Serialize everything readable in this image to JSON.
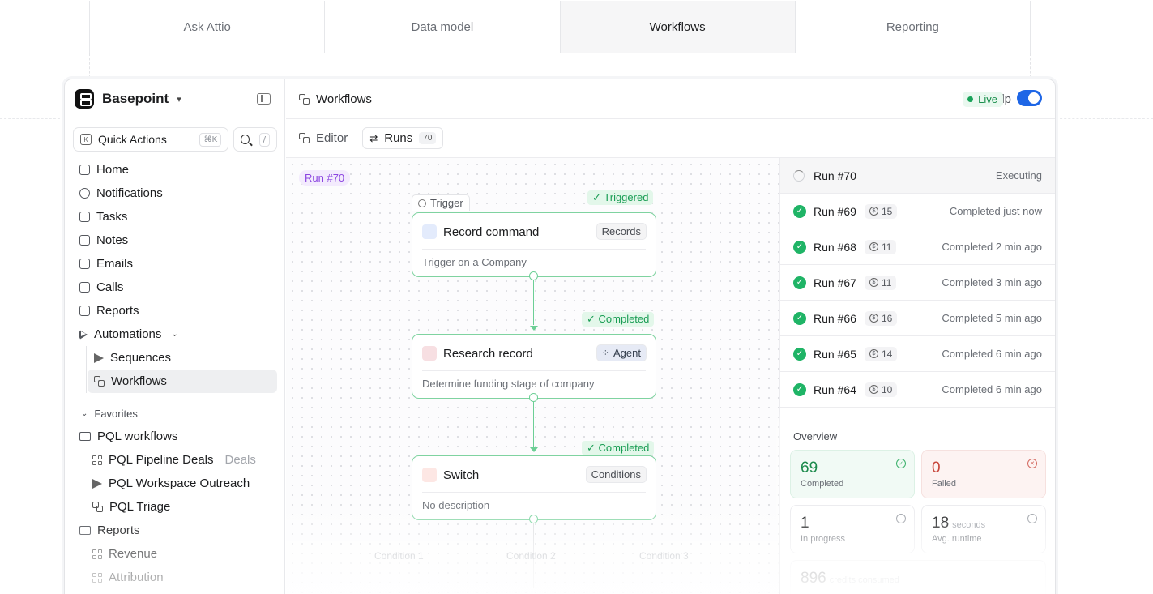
{
  "top_tabs": [
    "Ask Attio",
    "Data model",
    "Workflows",
    "Reporting"
  ],
  "sidebar": {
    "workspace": "Basepoint",
    "quick_actions": "Quick Actions",
    "quick_actions_kbd": "⌘K",
    "search_kbd": "/",
    "nav": [
      "Home",
      "Notifications",
      "Tasks",
      "Notes",
      "Emails",
      "Calls",
      "Reports",
      "Automations"
    ],
    "automations_children": [
      "Sequences",
      "Workflows"
    ],
    "favorites_label": "Favorites",
    "favorites": {
      "folder1": "PQL workflows",
      "folder1_items": [
        "PQL Pipeline Deals",
        "PQL Workspace Outreach",
        "PQL Triage"
      ],
      "folder1_item1_tag": "Deals",
      "folder2": "Reports",
      "folder2_items": [
        "Revenue",
        "Attribution"
      ]
    }
  },
  "header": {
    "title": "Workflows",
    "help": "Help"
  },
  "toolbar": {
    "editor": "Editor",
    "runs": "Runs",
    "runs_count": "70",
    "live": "Live",
    "live_on": true
  },
  "canvas": {
    "run_tag": "Run #70",
    "trigger_label": "Trigger",
    "nodes": [
      {
        "status": "Triggered",
        "title": "Record command",
        "tag": "Records",
        "desc": "Trigger on a Company"
      },
      {
        "status": "Completed",
        "title": "Research record",
        "tag": "Agent",
        "desc": "Determine funding stage of company"
      },
      {
        "status": "Completed",
        "title": "Switch",
        "tag": "Conditions",
        "desc": "No description"
      }
    ],
    "conditions": [
      "Condition 1",
      "Condition 2",
      "Condition 3"
    ]
  },
  "runs": {
    "executing": {
      "name": "Run #70",
      "status": "Executing"
    },
    "completed": [
      {
        "name": "Run #69",
        "credits": "15",
        "status": "Completed just now"
      },
      {
        "name": "Run #68",
        "credits": "11",
        "status": "Completed 2 min ago"
      },
      {
        "name": "Run #67",
        "credits": "11",
        "status": "Completed 3 min ago"
      },
      {
        "name": "Run #66",
        "credits": "16",
        "status": "Completed 5 min ago"
      },
      {
        "name": "Run #65",
        "credits": "14",
        "status": "Completed 6 min ago"
      },
      {
        "name": "Run #64",
        "credits": "10",
        "status": "Completed 6 min ago"
      }
    ]
  },
  "overview": {
    "title": "Overview",
    "completed": {
      "value": "69",
      "label": "Completed"
    },
    "failed": {
      "value": "0",
      "label": "Failed"
    },
    "in_progress": {
      "value": "1",
      "label": "In progress"
    },
    "avg_runtime": {
      "value": "18",
      "unit": "seconds",
      "label": "Avg. runtime"
    },
    "credits": {
      "value": "896",
      "label": "credits consumed"
    }
  },
  "colors": {
    "accent": "#1e66e6",
    "success": "#1fb466",
    "purple": "#8b45e0"
  }
}
